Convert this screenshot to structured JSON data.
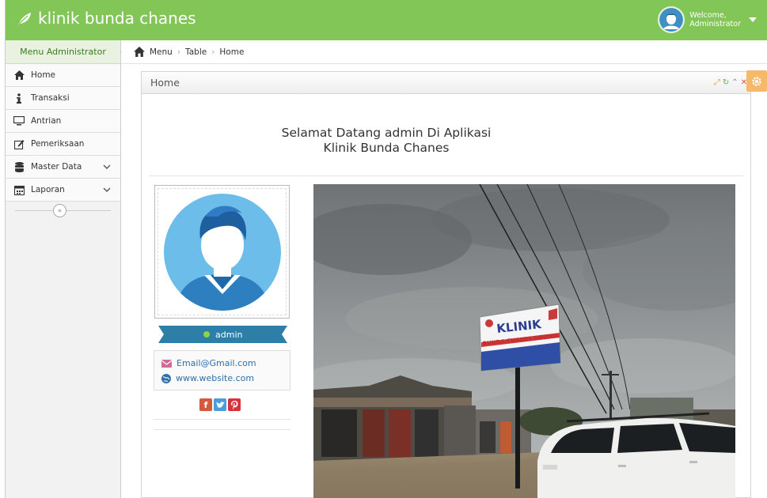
{
  "app": {
    "brand": "klinik bunda chanes",
    "user_greeting": "Welcome,",
    "user_name": "Administrator"
  },
  "sidebar": {
    "header": "Menu Administrator",
    "items": [
      {
        "label": "Home",
        "icon": "home-icon"
      },
      {
        "label": "Transaksi",
        "icon": "info-icon"
      },
      {
        "label": "Antrian",
        "icon": "monitor-icon"
      },
      {
        "label": "Pemeriksaan",
        "icon": "edit-icon"
      },
      {
        "label": "Master Data",
        "icon": "database-icon"
      },
      {
        "label": "Laporan",
        "icon": "calendar-icon"
      }
    ]
  },
  "breadcrumb": [
    "Menu",
    "Table",
    "Home"
  ],
  "widget": {
    "title": "Home",
    "welcome_line1": "Selamat Datang admin Di Aplikasi",
    "welcome_line2": "Klinik Bunda Chanes"
  },
  "profile": {
    "username": "admin",
    "email": "Email@Gmail.com",
    "website": "www.website.com"
  },
  "photo": {
    "sign_line1": "KLINIK",
    "sign_line2": "BUNDA CHANES MEDIKA"
  },
  "colors": {
    "navbar": "#82c658",
    "ribbon": "#2e7fa8",
    "online_dot": "#8bd34d",
    "settings_btn": "#f6b96a"
  }
}
